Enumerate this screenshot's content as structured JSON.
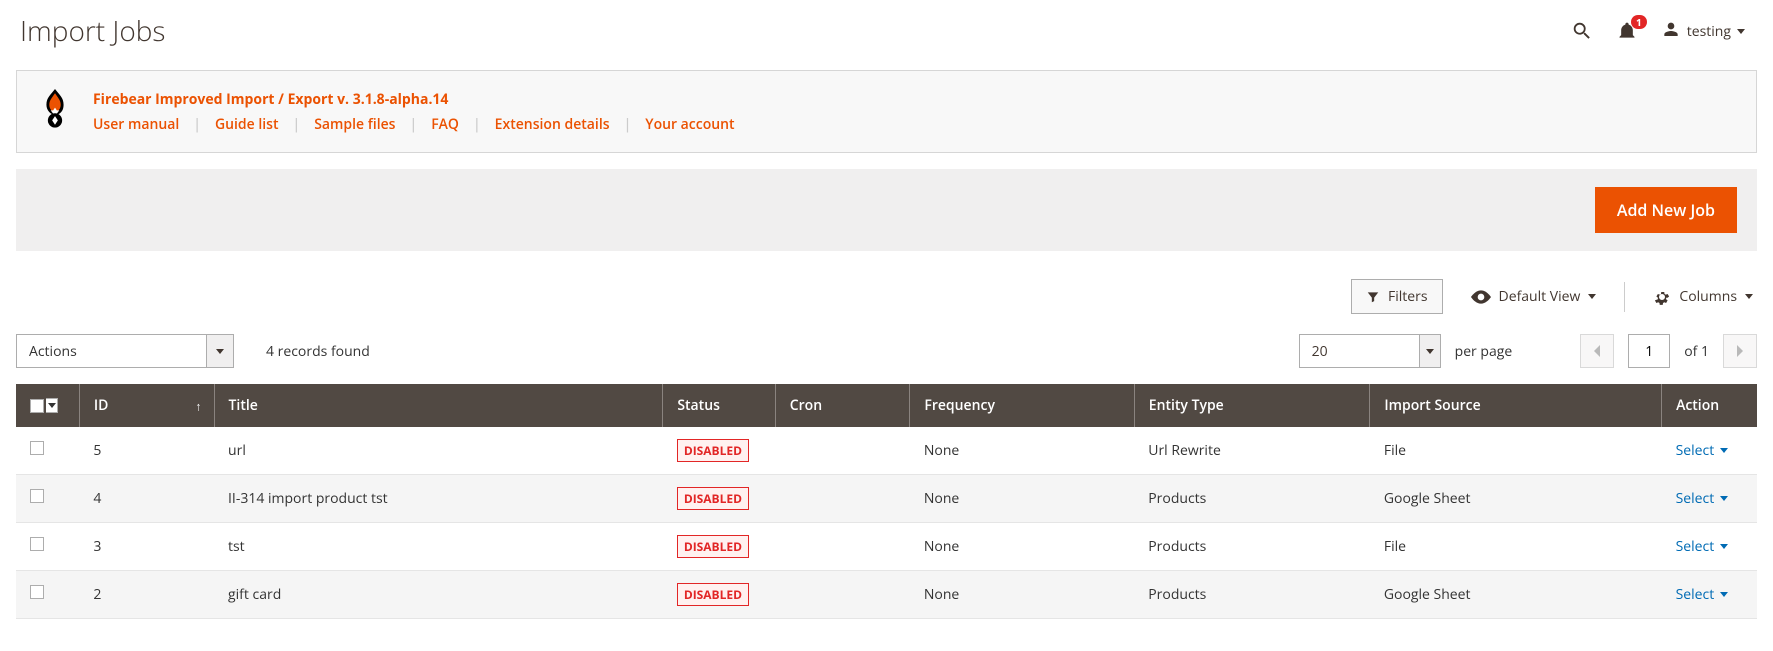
{
  "page_title": "Import Jobs",
  "notifications": {
    "count": "1"
  },
  "user": {
    "name": "testing"
  },
  "banner": {
    "title": "Firebear Improved Import / Export v. 3.1.8-alpha.14",
    "links": [
      "User manual",
      "Guide list",
      "Sample files",
      "FAQ",
      "Extension details",
      "Your account"
    ]
  },
  "buttons": {
    "add_new_job": "Add New Job",
    "filters": "Filters",
    "default_view": "Default View",
    "columns": "Columns",
    "actions": "Actions"
  },
  "grid_meta": {
    "records_found": "4 records found",
    "per_page_value": "20",
    "per_page_label": "per page",
    "page_current": "1",
    "page_total_label": "of 1"
  },
  "columns": {
    "id": "ID",
    "title": "Title",
    "status": "Status",
    "cron": "Cron",
    "frequency": "Frequency",
    "entity_type": "Entity Type",
    "import_source": "Import Source",
    "action": "Action"
  },
  "action_link_label": "Select",
  "rows": [
    {
      "id": "5",
      "title": "url",
      "status": "DISABLED",
      "cron": "",
      "frequency": "None",
      "entity_type": "Url Rewrite",
      "import_source": "File"
    },
    {
      "id": "4",
      "title": "II-314 import product tst",
      "status": "DISABLED",
      "cron": "",
      "frequency": "None",
      "entity_type": "Products",
      "import_source": "Google Sheet"
    },
    {
      "id": "3",
      "title": "tst",
      "status": "DISABLED",
      "cron": "",
      "frequency": "None",
      "entity_type": "Products",
      "import_source": "File"
    },
    {
      "id": "2",
      "title": "gift card",
      "status": "DISABLED",
      "cron": "",
      "frequency": "None",
      "entity_type": "Products",
      "import_source": "Google Sheet"
    }
  ]
}
